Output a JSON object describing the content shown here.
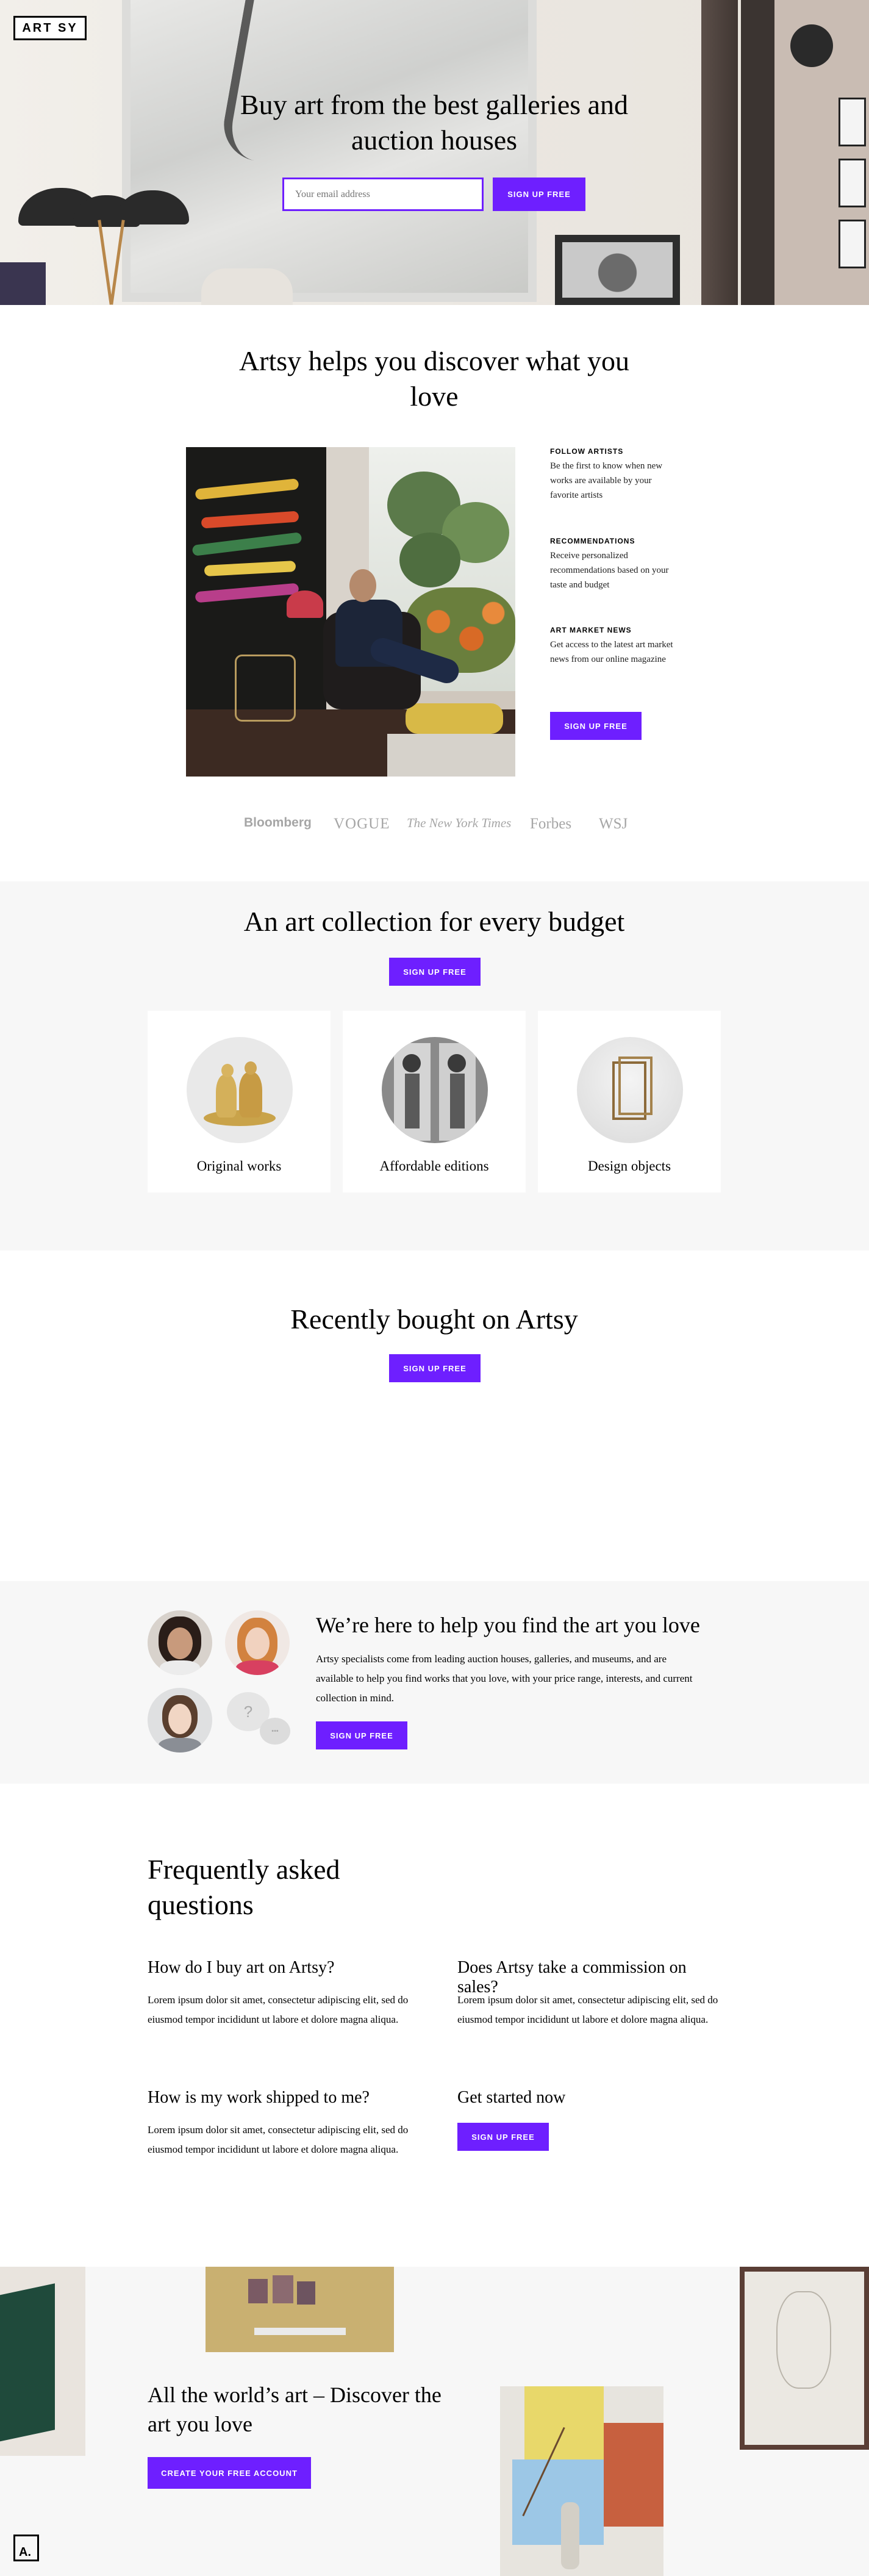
{
  "brand": {
    "logo_text": "ART SY",
    "corner_logo": "A."
  },
  "hero": {
    "title": "Buy art from the best galleries and auction houses",
    "email_placeholder": "Your email address",
    "signup_label": "SIGN UP FREE"
  },
  "discover": {
    "title": "Artsy helps you discover what you love",
    "features": [
      {
        "heading": "FOLLOW ARTISTS",
        "text": "Be the first to know when new works are available by your favorite artists"
      },
      {
        "heading": "RECOMMENDATIONS",
        "text": "Receive personalized recommendations based on your taste and budget"
      },
      {
        "heading": "ART MARKET NEWS",
        "text": "Get access to the latest art market news from our online magazine"
      }
    ],
    "signup_label": "SIGN UP FREE"
  },
  "press": [
    "Bloomberg",
    "VOGUE",
    "The New York Times",
    "Forbes",
    "WSJ"
  ],
  "budget": {
    "title": "An art collection for every budget",
    "signup_label": "SIGN UP FREE",
    "categories": [
      {
        "label": "Original works"
      },
      {
        "label": "Affordable editions"
      },
      {
        "label": "Design objects"
      }
    ]
  },
  "recent": {
    "title": "Recently bought on Artsy",
    "signup_label": "SIGN UP FREE"
  },
  "specialists": {
    "title": "We’re here to help you find the art you love",
    "text": "Artsy specialists come from leading auction houses, galleries, and museums, and are available to help you find works that you love, with your price range, interests, and current collection in mind.",
    "signup_label": "SIGN UP FREE",
    "bubble_mark": "?",
    "bubble_dots": "•••"
  },
  "faq": {
    "title": "Frequently asked questions",
    "items": [
      {
        "question": "How do I buy art on Artsy?",
        "answer": "Lorem ipsum dolor sit amet, consectetur adipiscing elit, sed do eiusmod tempor incididunt ut labore et dolore magna aliqua."
      },
      {
        "question": "Does Artsy take a commission on sales?",
        "answer": "Lorem ipsum dolor sit amet, consectetur adipiscing elit, sed do eiusmod tempor incididunt ut labore et dolore magna aliqua."
      },
      {
        "question": "How is my work shipped to me?",
        "answer": "Lorem ipsum dolor sit amet, consectetur adipiscing elit, sed do eiusmod tempor incididunt ut labore et dolore magna aliqua."
      }
    ],
    "get_started": "Get started now",
    "signup_label": "SIGN UP FREE"
  },
  "footer": {
    "title": "All the world’s art – Discover the art you love",
    "cta_label": "CREATE YOUR FREE ACCOUNT"
  },
  "colors": {
    "accent": "#6e1fff",
    "section_gray": "#f7f7f7"
  }
}
